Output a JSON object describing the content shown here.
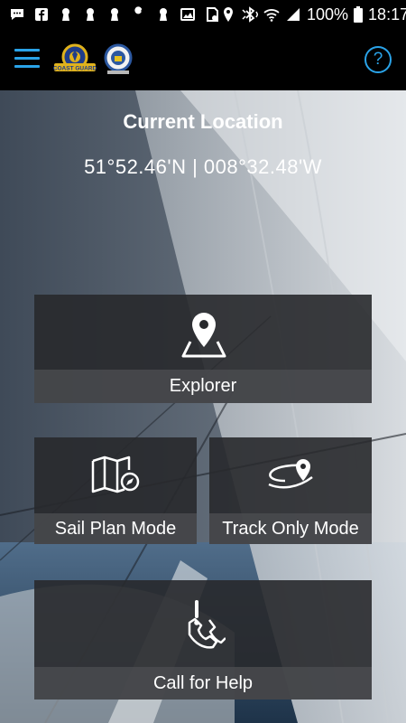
{
  "status_bar": {
    "battery": "100%",
    "time": "18:17",
    "left_icons": [
      "messages-icon",
      "facebook-icon",
      "keyhole-icon",
      "keyhole-icon",
      "keyhole-icon",
      "wrench-icon",
      "keyhole-icon",
      "image-icon",
      "sd-card-icon"
    ],
    "right_icons": [
      "location-pin-icon",
      "bluetooth-muted-icon",
      "wifi-icon",
      "signal-icon",
      "battery-icon"
    ]
  },
  "app_bar": {
    "menu_icon": "hamburger-icon",
    "logo_1": "coast-guard-logo",
    "logo_1_text": "COAST GUARD",
    "logo_2": "crest-logo",
    "help_label": "?"
  },
  "location": {
    "title": "Current Location",
    "coordinates": "51°52.46'N | 008°32.48'W"
  },
  "tiles": {
    "explorer": {
      "label": "Explorer",
      "icon": "map-pin-icon"
    },
    "sail_plan": {
      "label": "Sail Plan Mode",
      "icon": "map-compass-icon"
    },
    "track_only": {
      "label": "Track Only Mode",
      "icon": "route-pin-icon"
    },
    "call_help": {
      "label": "Call for Help",
      "icon": "phone-alert-icon"
    }
  },
  "colors": {
    "accent": "#2aa3e8",
    "tile_bg": "#28292c",
    "tile_label_bg": "#4b4c4f"
  }
}
